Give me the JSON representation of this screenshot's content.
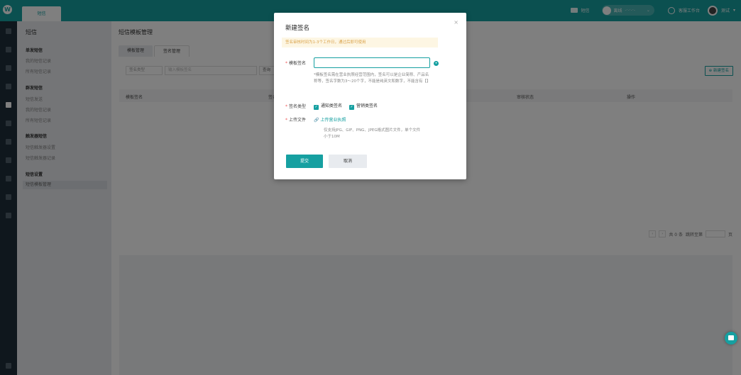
{
  "colors": {
    "accent": "#16a0a1",
    "notice_text": "#d9a24a",
    "required": "#e55555"
  },
  "topbar": {
    "tab_label": "短信",
    "sms_label": "短信",
    "status_label": "离线",
    "status_detail": "-·-·-·-",
    "workbench_label": "客服工作台",
    "user_label": "测试"
  },
  "sidebar": {
    "title": "短信",
    "groups": [
      {
        "label": "单发短信",
        "items": [
          "我的短信记录",
          "所有短信记录"
        ]
      },
      {
        "label": "群发短信",
        "items": [
          "短信发送",
          "我的短信记录",
          "所有短信记录"
        ]
      },
      {
        "label": "触发器短信",
        "items": [
          "短信触发器设置",
          "短信触发器记录"
        ]
      },
      {
        "label": "短信设置",
        "items": [
          "短信模板管理"
        ]
      }
    ]
  },
  "main": {
    "page_title": "短信模板管理",
    "tabs": [
      "模板管理",
      "签名管理"
    ],
    "filter": {
      "type_select": "签名类型",
      "input_placeholder": "输入模板签名",
      "query_label": "查询"
    },
    "new_button": "新建签名",
    "columns": [
      "模板签名",
      "签名类型",
      "审核状态",
      "操作"
    ],
    "pager": {
      "total": "共 0 条",
      "jump": "跳转至第",
      "page": "页"
    }
  },
  "modal": {
    "title": "新建签名",
    "notice": "签名审核时间为1-3个工作日，通过后即可使用",
    "sig_label": "模板签名",
    "sig_hint": "*模板签名需在营业执照经营范围内，签名可以是企业简称、产品名称等，签名字数为3～20个字，不能是纯英文和数字，不能含有【】",
    "type_label": "签名类型",
    "type_options": [
      "通知类签名",
      "营销类签名"
    ],
    "file_label": "上传文件",
    "upload_link": "上传营业执照",
    "upload_hint": "仅支持JPG、GIF、PNG、JPEG格式图片文件，单个文件小于10M",
    "submit": "提交",
    "cancel": "取消"
  }
}
